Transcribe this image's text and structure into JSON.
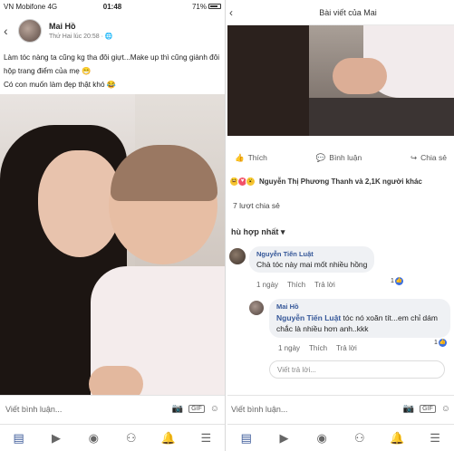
{
  "left": {
    "status": {
      "carrier": "VN Mobifone  4G",
      "time": "01:48",
      "battery": "71%"
    },
    "post": {
      "author": "Mai Hồ",
      "meta": "Thứ Hai lúc 20:58 · ",
      "text_line1": "Làm tóc nàng ta cũng kg tha đôi giựt...Make up thì cũng giành đôi hộp trang điểm của mẹ 😁",
      "text_line2": "Có con muốn làm đẹp thật khó 😂"
    },
    "comment_bar": {
      "placeholder": "Viết bình luận...",
      "gif": "GIF"
    },
    "tabs": [
      {
        "icon": "news-feed-icon"
      },
      {
        "icon": "watch-icon"
      },
      {
        "icon": "profile-icon"
      },
      {
        "icon": "groups-icon"
      },
      {
        "icon": "notifications-icon"
      },
      {
        "icon": "menu-icon"
      }
    ]
  },
  "right": {
    "header": {
      "title": "Bài viết của Mai"
    },
    "actions": {
      "like": "Thích",
      "comment": "Bình luận",
      "share": "Chia sẻ"
    },
    "reactions": {
      "names": "Nguyễn Thị Phương Thanh và 2,1K người khác"
    },
    "shares": "7 lượt chia sẻ",
    "sort": "hù hợp nhất",
    "comment1": {
      "author": "Nguyễn Tiến Luật",
      "text": "Chà tóc này mai mốt nhiều hồng",
      "time": "1 ngày",
      "like": "Thích",
      "reply": "Trả lời",
      "likes": "1"
    },
    "reply1": {
      "author": "Mai Hồ",
      "tag": "Nguyễn Tiến Luật",
      "text": " tóc nó xoăn tít...em chỉ dám chắc là nhiều hơn anh..kkk",
      "time": "1 ngày",
      "like": "Thích",
      "reply": "Trả lời",
      "likes": "1"
    },
    "reply_placeholder": "Viết trả lời...",
    "comment_bar": {
      "placeholder": "Viết bình luận...",
      "gif": "GIF"
    }
  }
}
